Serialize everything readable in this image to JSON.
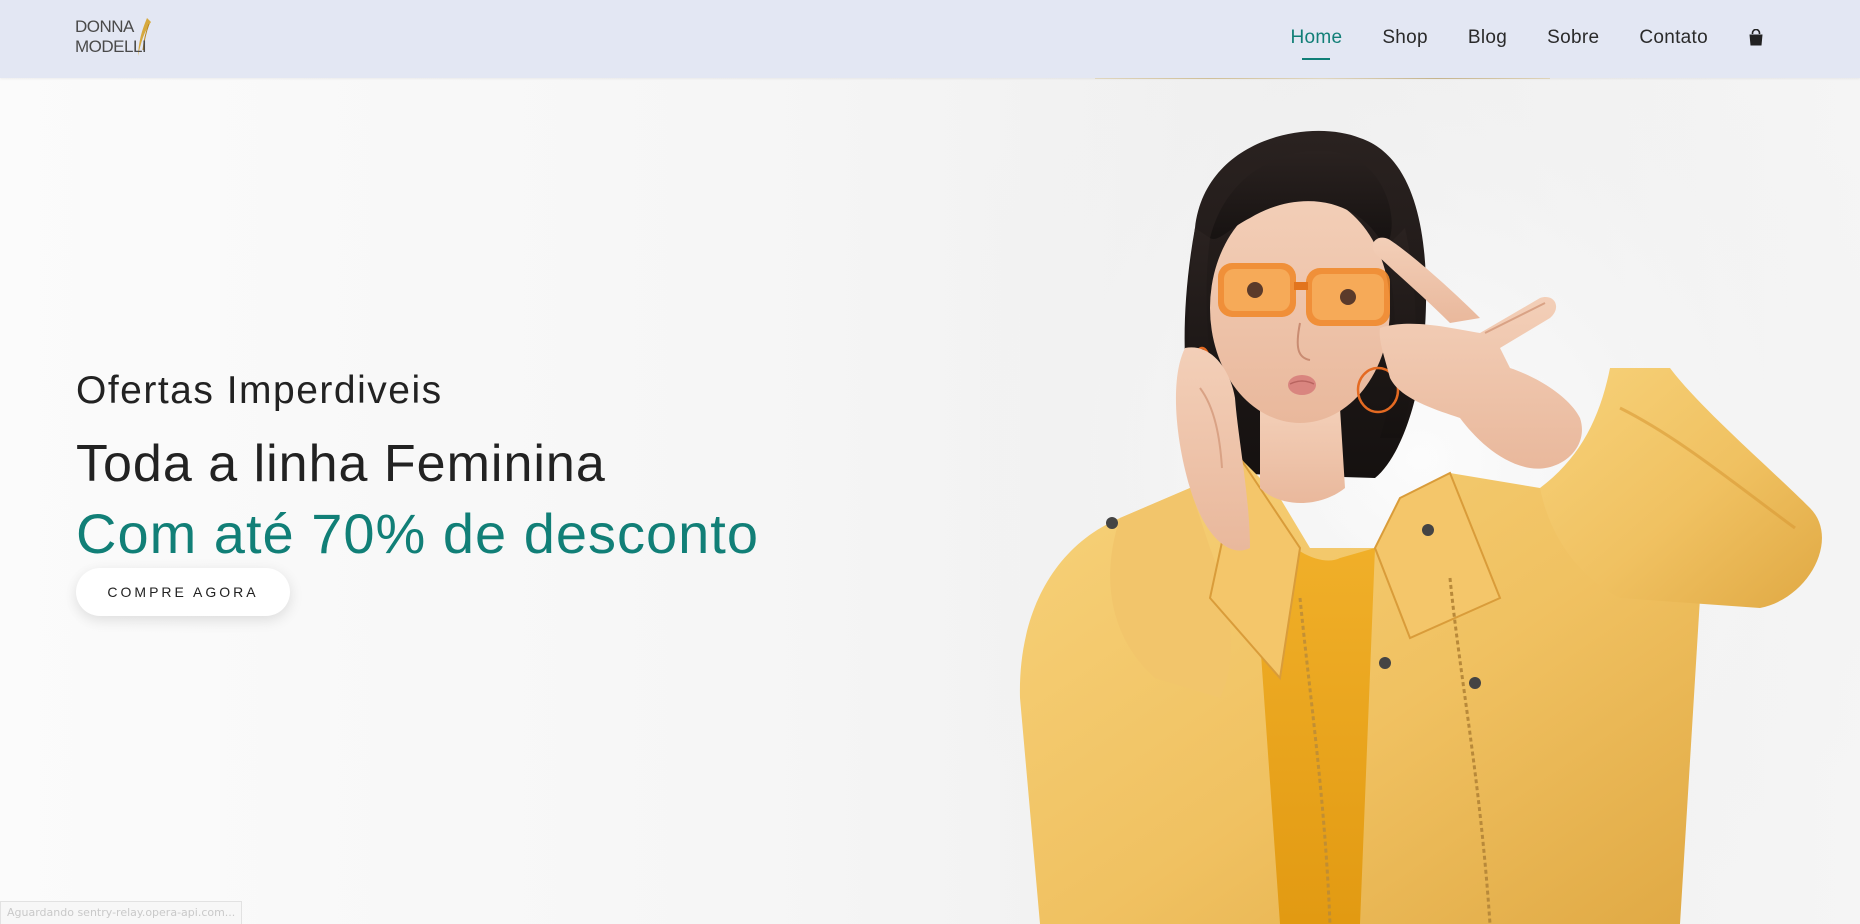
{
  "brand": {
    "logo_text": "DONNA MODELLI",
    "accent_color": "#117f77",
    "logo_accent_color": "#d4a22a"
  },
  "nav": {
    "items": [
      {
        "label": "Home",
        "active": true
      },
      {
        "label": "Shop",
        "active": false
      },
      {
        "label": "Blog",
        "active": false
      },
      {
        "label": "Sobre",
        "active": false
      },
      {
        "label": "Contato",
        "active": false
      }
    ],
    "cart_icon": "shopping-bag-icon"
  },
  "hero": {
    "kicker": "Ofertas Imperdiveis",
    "headline": "Toda a linha Feminina",
    "subheadline": "Com até 70% de desconto",
    "cta_label": "COMPRE AGORA"
  },
  "status_bar": {
    "text": "Aguardando sentry-relay.opera-api.com..."
  }
}
